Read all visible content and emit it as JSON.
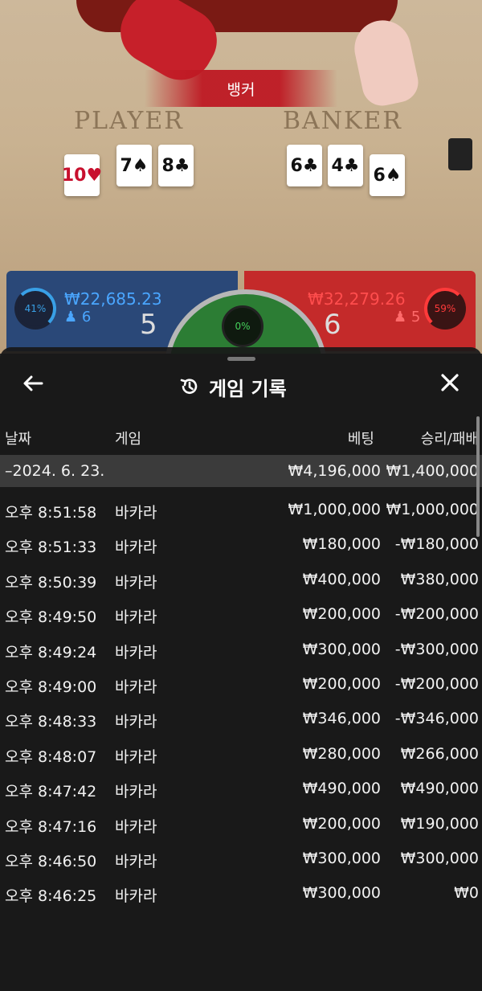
{
  "table": {
    "result_banner": "뱅커",
    "player_title": "PLAYER",
    "banker_title": "BANKER",
    "player_cards": [
      {
        "rank": "10",
        "suit": "♥",
        "color": "red"
      },
      {
        "rank": "7",
        "suit": "♠",
        "color": "black"
      },
      {
        "rank": "8",
        "suit": "♣",
        "color": "black"
      }
    ],
    "banker_cards": [
      {
        "rank": "6",
        "suit": "♣",
        "color": "black"
      },
      {
        "rank": "4",
        "suit": "♣",
        "color": "black"
      },
      {
        "rank": "6",
        "suit": "♠",
        "color": "black"
      }
    ]
  },
  "score": {
    "player_percent": "41%",
    "player_amount": "₩22,685.23",
    "player_count": "6",
    "player_score": "5",
    "tie_percent": "0%",
    "banker_percent": "59%",
    "banker_amount": "₩32,279.26",
    "banker_count": "5",
    "banker_score": "6",
    "colors": {
      "player": "#2a4878",
      "banker": "#c42a2a",
      "tie": "#2c7d34"
    }
  },
  "sheet": {
    "title": "게임 기록",
    "back_icon": "arrow-left-icon",
    "close_icon": "close-icon",
    "history_icon": "history-icon",
    "columns": {
      "date": "날짜",
      "game": "게임",
      "bet": "베팅",
      "win_loss": "승리/패배"
    },
    "date_group": {
      "date": "–2024. 6. 23.",
      "bet": "₩4,196,000",
      "win_loss": "₩1,400,000"
    },
    "rows": [
      {
        "time": "오후 8:51:58",
        "game": "바카라",
        "bet": "₩1,000,000",
        "win_loss": "₩1,000,000"
      },
      {
        "time": "오후 8:51:33",
        "game": "바카라",
        "bet": "₩180,000",
        "win_loss": "-₩180,000"
      },
      {
        "time": "오후 8:50:39",
        "game": "바카라",
        "bet": "₩400,000",
        "win_loss": "₩380,000"
      },
      {
        "time": "오후 8:49:50",
        "game": "바카라",
        "bet": "₩200,000",
        "win_loss": "-₩200,000"
      },
      {
        "time": "오후 8:49:24",
        "game": "바카라",
        "bet": "₩300,000",
        "win_loss": "-₩300,000"
      },
      {
        "time": "오후 8:49:00",
        "game": "바카라",
        "bet": "₩200,000",
        "win_loss": "-₩200,000"
      },
      {
        "time": "오후 8:48:33",
        "game": "바카라",
        "bet": "₩346,000",
        "win_loss": "-₩346,000"
      },
      {
        "time": "오후 8:48:07",
        "game": "바카라",
        "bet": "₩280,000",
        "win_loss": "₩266,000"
      },
      {
        "time": "오후 8:47:42",
        "game": "바카라",
        "bet": "₩490,000",
        "win_loss": "₩490,000"
      },
      {
        "time": "오후 8:47:16",
        "game": "바카라",
        "bet": "₩200,000",
        "win_loss": "₩190,000"
      },
      {
        "time": "오후 8:46:50",
        "game": "바카라",
        "bet": "₩300,000",
        "win_loss": "₩300,000"
      },
      {
        "time": "오후 8:46:25",
        "game": "바카라",
        "bet": "₩300,000",
        "win_loss": "₩0"
      }
    ]
  }
}
